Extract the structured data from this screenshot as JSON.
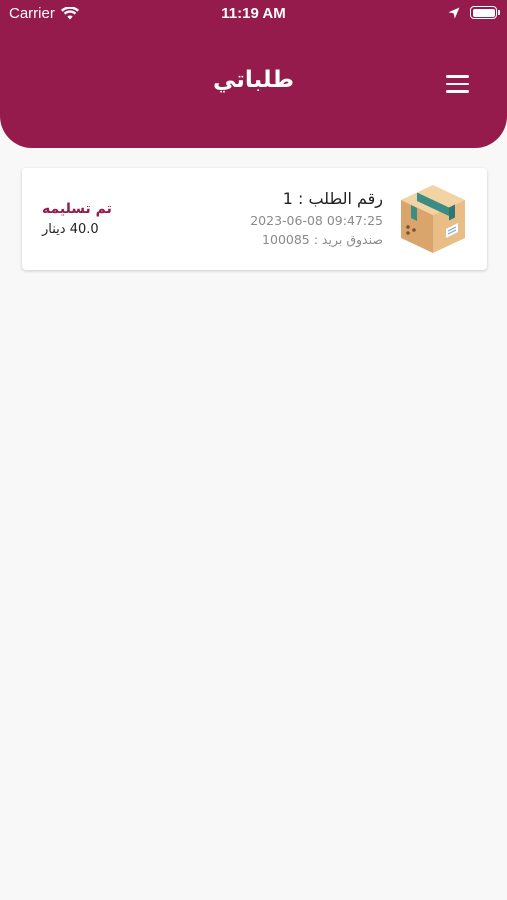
{
  "status_bar": {
    "carrier": "Carrier",
    "time": "11:19 AM",
    "icons": [
      "wifi-icon",
      "location-arrow-icon",
      "battery-icon"
    ]
  },
  "header": {
    "title": "طلباتي",
    "menu_icon": "hamburger-menu-icon",
    "background_color": "#951b4d"
  },
  "orders": [
    {
      "number_label": "رقم الطلب : 1",
      "datetime": "2023-06-08 09:47:25",
      "address": "صندوق بريد : 100085",
      "status": "تم تسليمه",
      "price": "40.0 دينار",
      "icon": "package-box-icon"
    }
  ],
  "colors": {
    "accent": "#951b4d",
    "background": "#f8f8f8",
    "card": "#ffffff"
  }
}
